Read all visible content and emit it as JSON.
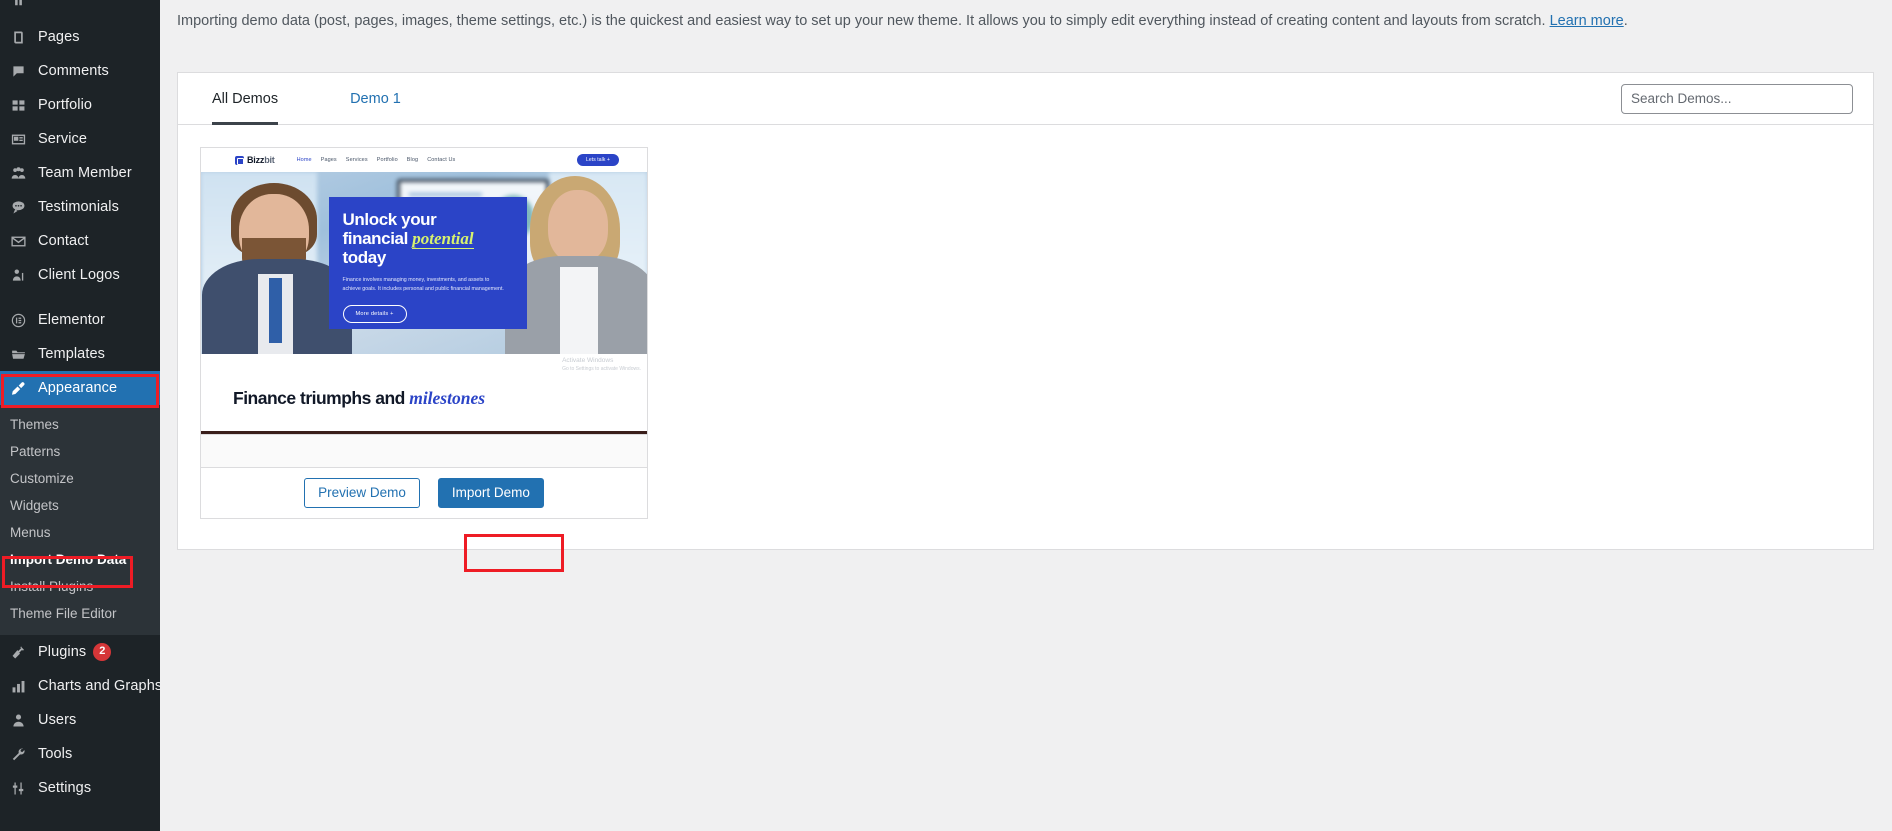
{
  "sidebar": {
    "items": [
      {
        "label": "Pages",
        "icon": "pages-icon",
        "badge": null
      },
      {
        "label": "Comments",
        "icon": "comments-icon",
        "badge": null
      },
      {
        "label": "Portfolio",
        "icon": "portfolio-icon",
        "badge": null
      },
      {
        "label": "Service",
        "icon": "service-icon",
        "badge": null
      },
      {
        "label": "Team Member",
        "icon": "team-member-icon",
        "badge": null
      },
      {
        "label": "Testimonials",
        "icon": "testimonials-icon",
        "badge": null
      },
      {
        "label": "Contact",
        "icon": "contact-icon",
        "badge": null
      },
      {
        "label": "Client Logos",
        "icon": "client-logos-icon",
        "badge": null
      }
    ],
    "items2": [
      {
        "label": "Elementor",
        "icon": "elementor-icon"
      },
      {
        "label": "Templates",
        "icon": "templates-icon"
      }
    ],
    "appearance": {
      "label": "Appearance",
      "icon": "appearance-icon"
    },
    "submenu": [
      {
        "label": "Themes",
        "current": false
      },
      {
        "label": "Patterns",
        "current": false
      },
      {
        "label": "Customize",
        "current": false
      },
      {
        "label": "Widgets",
        "current": false
      },
      {
        "label": "Menus",
        "current": false
      },
      {
        "label": "Import Demo Data",
        "current": true
      },
      {
        "label": "Install Plugins",
        "current": false
      },
      {
        "label": "Theme File Editor",
        "current": false
      }
    ],
    "items3": [
      {
        "label": "Plugins",
        "icon": "plugins-icon",
        "badge": "2"
      },
      {
        "label": "Charts and Graphs",
        "icon": "charts-and-graphs-icon",
        "badge": null
      },
      {
        "label": "Users",
        "icon": "users-icon",
        "badge": null
      },
      {
        "label": "Tools",
        "icon": "tools-icon",
        "badge": null
      },
      {
        "label": "Settings",
        "icon": "settings-icon",
        "badge": null
      }
    ]
  },
  "main": {
    "intro_part1": "Importing demo data (post, pages, images, theme settings, etc.) is the quickest and easiest way to set up your new theme. It allows you to simply edit everything instead of creating content and layouts from scratch. ",
    "intro_link": "Learn more",
    "intro_part2": ".",
    "tabs": [
      {
        "label": "All Demos",
        "active": true
      },
      {
        "label": "Demo 1",
        "active": false
      }
    ],
    "search": {
      "value": "",
      "placeholder": "Search Demos..."
    },
    "demo_card": {
      "preview_label": "Preview Demo",
      "import_label": "Import Demo",
      "title": "",
      "thumbnail": {
        "brand": "Bizz",
        "brand_suffix": "bit",
        "nav": [
          "Home",
          "Pages",
          "Services",
          "Portfolio",
          "Blog",
          "Contact Us"
        ],
        "cta": "Lets talk  +",
        "hero_line1": "Unlock your",
        "hero_line2": "financial ",
        "hero_emphasis": "potential",
        "hero_line3": "today",
        "hero_paragraph": "Finance involves managing money, investments, and assets to achieve goals. It includes personal and public financial management.",
        "hero_button": "More details  +",
        "footer_heading": "Finance triumphs and ",
        "footer_heading_emphasis": "milestones",
        "watermark_line1": "Activate Windows",
        "watermark_line2": "Go to Settings to activate Windows."
      }
    }
  },
  "colors": {
    "sidebar_bg": "#1d2327",
    "submenu_bg": "#2c3338",
    "accent": "#2271b1",
    "annotation": "#ee1c25",
    "badge": "#d63638",
    "brand_blue": "#2b44c7",
    "hero_accent": "#d7f26e"
  }
}
